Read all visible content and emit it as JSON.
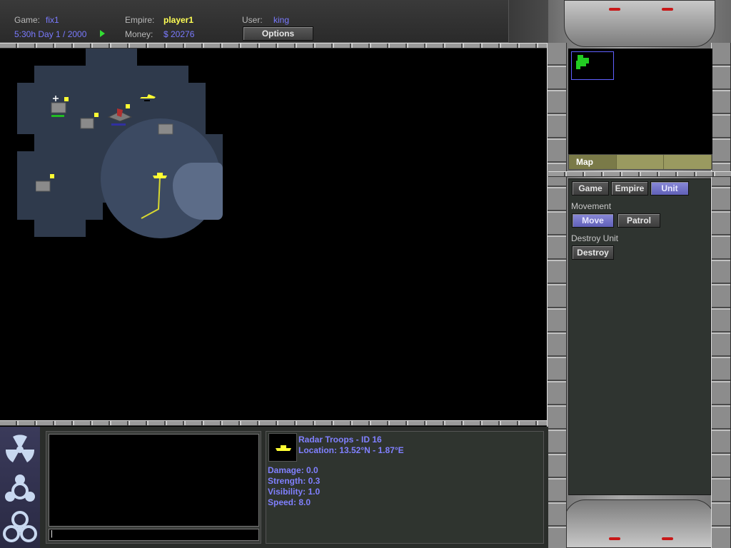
{
  "header": {
    "game_label": "Game:",
    "game_value": "fix1",
    "empire_label": "Empire:",
    "empire_value": "player1",
    "user_label": "User:",
    "user_value": "king",
    "time_value": "5:30h Day 1 / 2000",
    "money_label": "Money:",
    "money_value": "$ 20276",
    "options_label": "Options"
  },
  "minimap": {
    "tabs": [
      {
        "label": "Map",
        "active": true
      },
      {
        "label": "",
        "active": false
      },
      {
        "label": "",
        "active": false
      }
    ]
  },
  "command_panel": {
    "tabs": [
      {
        "label": "Game",
        "active": false
      },
      {
        "label": "Empire",
        "active": false
      },
      {
        "label": "Unit",
        "active": true
      }
    ],
    "movement_label": "Movement",
    "move_label": "Move",
    "patrol_label": "Patrol",
    "destroy_section_label": "Destroy Unit",
    "destroy_label": "Destroy"
  },
  "selected_unit": {
    "title": "Radar Troops - ID 16",
    "location": "Location: 13.52°N - 1.87°E",
    "damage": "Damage: 0.0",
    "strength": "Strength: 0.3",
    "visibility": "Visibility: 1.0",
    "speed": "Speed: 8.0"
  },
  "side_icons": [
    "radiation-icon",
    "chemical-icon",
    "biohazard-icon"
  ],
  "colors": {
    "accent_blue": "#7a7aff",
    "accent_yellow": "#ffff55",
    "active_button": "#7070c8",
    "fog": "#2f3a4c"
  }
}
